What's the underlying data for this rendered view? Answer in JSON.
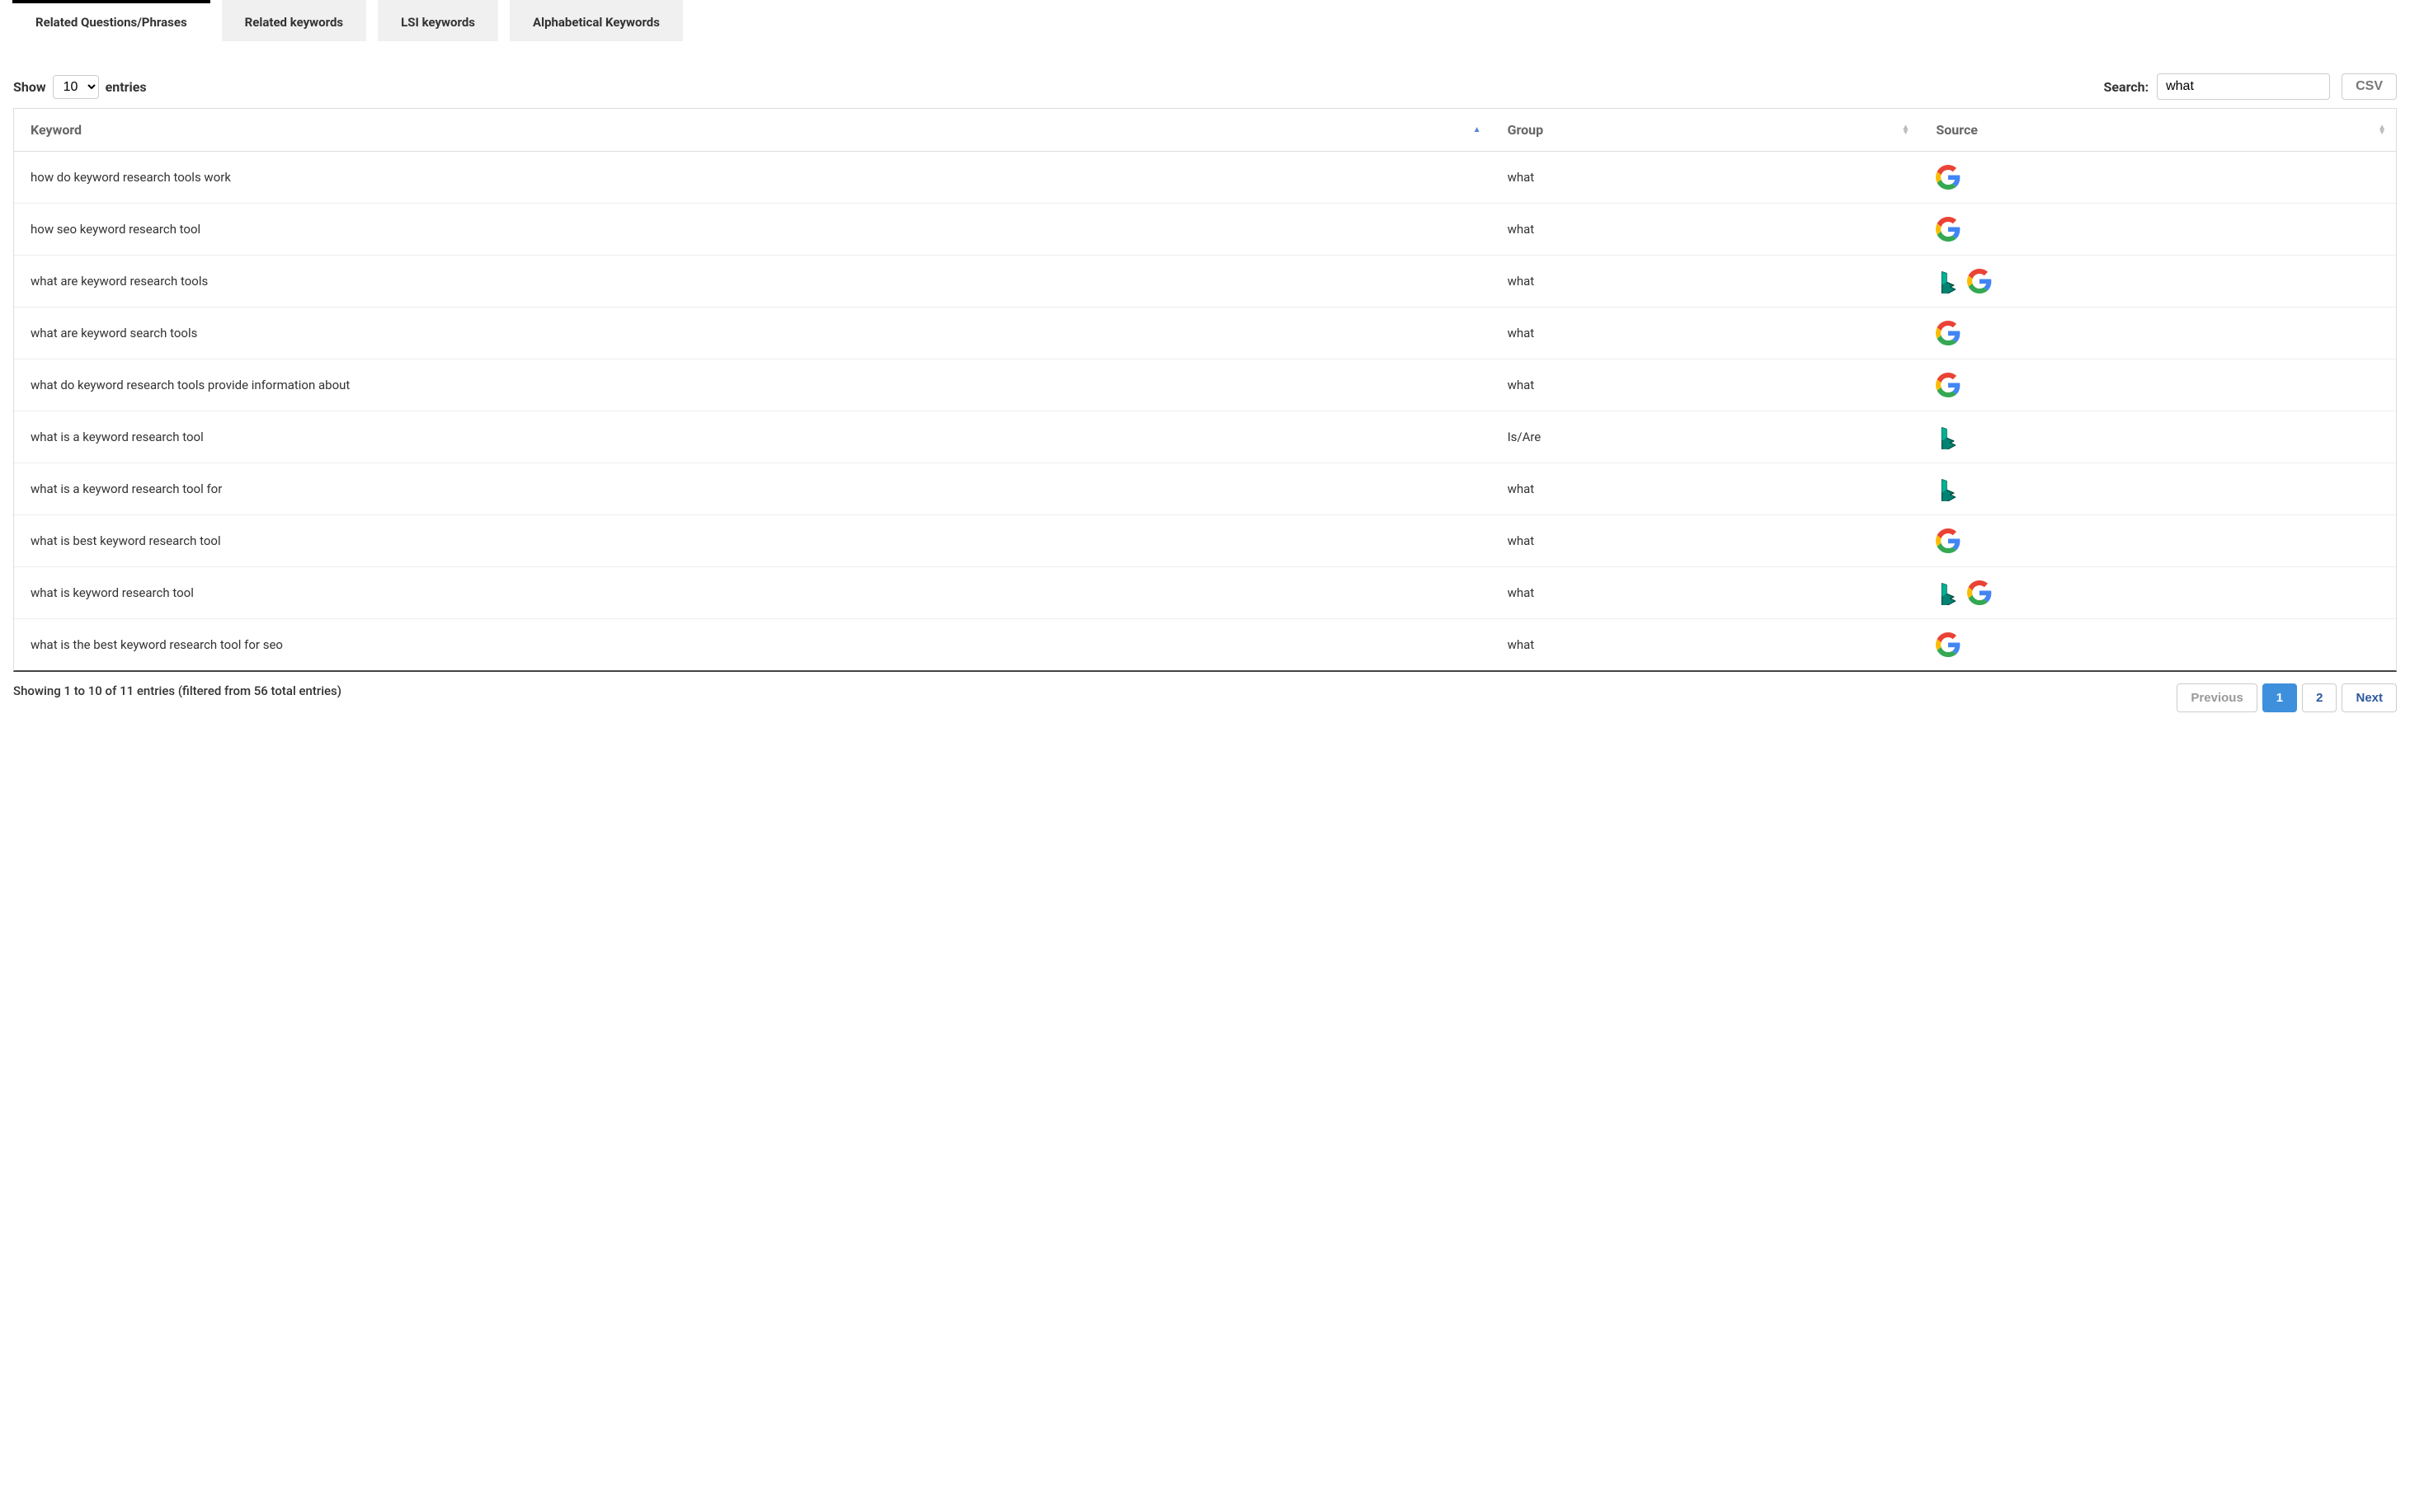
{
  "tabs": [
    {
      "label": "Related Questions/Phrases",
      "active": true
    },
    {
      "label": "Related keywords",
      "active": false
    },
    {
      "label": "LSI keywords",
      "active": false
    },
    {
      "label": "Alphabetical Keywords",
      "active": false
    }
  ],
  "entries": {
    "show_label": "Show",
    "entries_label": "entries",
    "page_size": "10"
  },
  "search": {
    "label": "Search:",
    "value": "what"
  },
  "csv_label": "CSV",
  "columns": {
    "keyword": "Keyword",
    "group": "Group",
    "source": "Source"
  },
  "rows": [
    {
      "keyword": "how do keyword research tools work",
      "group": "what",
      "sources": [
        "google"
      ]
    },
    {
      "keyword": "how seo keyword research tool",
      "group": "what",
      "sources": [
        "google"
      ]
    },
    {
      "keyword": "what are keyword research tools",
      "group": "what",
      "sources": [
        "bing",
        "google"
      ]
    },
    {
      "keyword": "what are keyword search tools",
      "group": "what",
      "sources": [
        "google"
      ]
    },
    {
      "keyword": "what do keyword research tools provide information about",
      "group": "what",
      "sources": [
        "google"
      ]
    },
    {
      "keyword": "what is a keyword research tool",
      "group": "Is/Are",
      "sources": [
        "bing"
      ]
    },
    {
      "keyword": "what is a keyword research tool for",
      "group": "what",
      "sources": [
        "bing"
      ]
    },
    {
      "keyword": "what is best keyword research tool",
      "group": "what",
      "sources": [
        "google"
      ]
    },
    {
      "keyword": "what is keyword research tool",
      "group": "what",
      "sources": [
        "bing",
        "google"
      ]
    },
    {
      "keyword": "what is the best keyword research tool for seo",
      "group": "what",
      "sources": [
        "google"
      ]
    }
  ],
  "info_text": "Showing 1 to 10 of 11 entries (filtered from 56 total entries)",
  "pagination": {
    "previous": "Previous",
    "next": "Next",
    "pages": [
      "1",
      "2"
    ],
    "current": "1"
  }
}
